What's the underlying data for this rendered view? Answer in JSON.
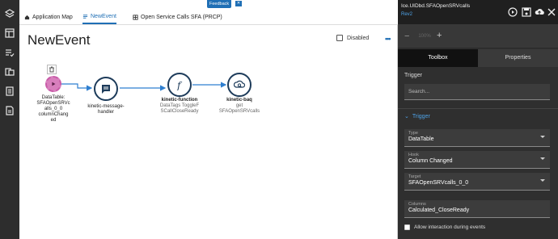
{
  "tabs": [
    {
      "label": "Application Map",
      "icon": "home-icon"
    },
    {
      "label": "NewEvent",
      "icon": "event-icon"
    },
    {
      "label": "Open Service Calls SFA (PRCP)",
      "icon": "grid-icon"
    }
  ],
  "feedback_label": "Feedback",
  "page_title": "NewEvent",
  "disabled_label": "Disabled",
  "flow": {
    "trigger": {
      "label": "DataTable:\nSFAOpenSRVc\nalls_0_0\ncolumnChang\ned"
    },
    "nodes": [
      {
        "label": "kinetic-message-\nhandler",
        "sub": "",
        "icon": "message-icon"
      },
      {
        "label": "kinetic-function",
        "sub": "DataTags ToggleF\nSCallCloseReady",
        "icon": "function-icon"
      },
      {
        "label": "kinetic-baq",
        "sub": "get\nSFAOpenSRVcalls",
        "icon": "cloud-search-icon"
      }
    ]
  },
  "panel": {
    "title": "Ice.UIDbd.SFAOpenSRVcalls",
    "rev": "Rev2",
    "zoom_value": "100%",
    "tabs": [
      "Toolbox",
      "Properties"
    ],
    "section_label": "Trigger",
    "search_placeholder": "Search...",
    "trigger_heading": "Trigger",
    "fields": [
      {
        "label": "Type",
        "value": "DataTable"
      },
      {
        "label": "Hook",
        "value": "Column Changed"
      },
      {
        "label": "Target",
        "value": "SFAOpenSRVcalls_0_0"
      },
      {
        "label": "Columns",
        "value": "Calculated_CloseReady"
      }
    ],
    "allow_label": "Allow interaction during events"
  },
  "colors": {
    "accent": "#1f6fb5",
    "node_border": "#1d3b5a",
    "trigger": "#d87fbd",
    "panel_bg": "#2f2f2f"
  }
}
